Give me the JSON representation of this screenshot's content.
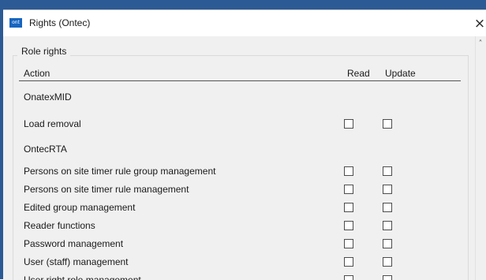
{
  "window": {
    "title": "Rights (Ontec)",
    "icon_text": "ont",
    "close_glyph": "×"
  },
  "group": {
    "title": "Role rights"
  },
  "table": {
    "columns": {
      "action": "Action",
      "read": "Read",
      "update": "Update"
    },
    "rows": [
      {
        "label": "OnatexMID",
        "type": "section"
      },
      {
        "label": "Load removal",
        "type": "right",
        "read": false,
        "update": false
      },
      {
        "label": "OntecRTA",
        "type": "section"
      },
      {
        "label": "Persons on site timer rule group management",
        "type": "right",
        "read": false,
        "update": false
      },
      {
        "label": "Persons on site timer rule management",
        "type": "right",
        "read": false,
        "update": false
      },
      {
        "label": "Edited group management",
        "type": "right",
        "read": false,
        "update": false
      },
      {
        "label": "Reader functions",
        "type": "right",
        "read": false,
        "update": false
      },
      {
        "label": "Password management",
        "type": "right",
        "read": false,
        "update": false
      },
      {
        "label": "User (staff) management",
        "type": "right",
        "read": false,
        "update": false
      },
      {
        "label": "User right role management",
        "type": "right",
        "read": false,
        "update": false
      }
    ]
  },
  "scrollbar": {
    "up_glyph": "˄"
  }
}
